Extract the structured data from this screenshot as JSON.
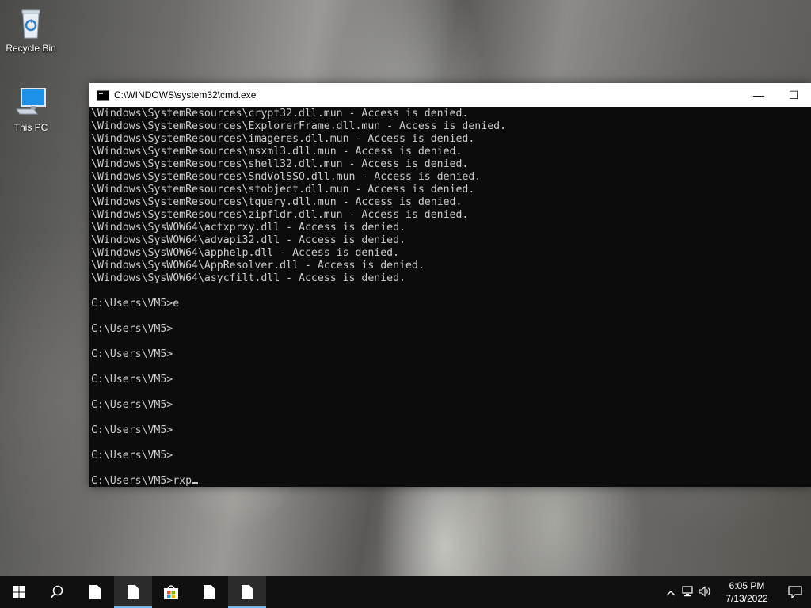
{
  "desktop": {
    "icons": [
      {
        "label": "Recycle Bin"
      },
      {
        "label": "This PC"
      }
    ]
  },
  "cmd": {
    "title": "C:\\WINDOWS\\system32\\cmd.exe",
    "lines": [
      "\\Windows\\SystemResources\\crypt32.dll.mun - Access is denied.",
      "\\Windows\\SystemResources\\ExplorerFrame.dll.mun - Access is denied.",
      "\\Windows\\SystemResources\\imageres.dll.mun - Access is denied.",
      "\\Windows\\SystemResources\\msxml3.dll.mun - Access is denied.",
      "\\Windows\\SystemResources\\shell32.dll.mun - Access is denied.",
      "\\Windows\\SystemResources\\SndVolSSO.dll.mun - Access is denied.",
      "\\Windows\\SystemResources\\stobject.dll.mun - Access is denied.",
      "\\Windows\\SystemResources\\tquery.dll.mun - Access is denied.",
      "\\Windows\\SystemResources\\zipfldr.dll.mun - Access is denied.",
      "\\Windows\\SysWOW64\\actxprxy.dll - Access is denied.",
      "\\Windows\\SysWOW64\\advapi32.dll - Access is denied.",
      "\\Windows\\SysWOW64\\apphelp.dll - Access is denied.",
      "\\Windows\\SysWOW64\\AppResolver.dll - Access is denied.",
      "\\Windows\\SysWOW64\\asycfilt.dll - Access is denied.",
      "",
      "C:\\Users\\VM5>e",
      "",
      "C:\\Users\\VM5>",
      "",
      "C:\\Users\\VM5>",
      "",
      "C:\\Users\\VM5>",
      "",
      "C:\\Users\\VM5>",
      "",
      "C:\\Users\\VM5>",
      "",
      "C:\\Users\\VM5>",
      ""
    ],
    "current_line": "C:\\Users\\VM5>rxp",
    "text_color": "#cccccc",
    "background": "#0c0c0c"
  },
  "window_controls": {
    "minimize": "—",
    "maximize": "☐"
  },
  "taskbar": {
    "start_icon": "windows-logo-icon",
    "search_icon": "search-icon",
    "pinned": [
      "document-icon",
      "document-icon",
      "store-icon",
      "document-icon",
      "document-icon"
    ],
    "active_index": 4,
    "accent": "#76b9ed",
    "tray": {
      "chevron": "^",
      "network_icon": "network-icon",
      "volume_icon": "volume-icon",
      "time": "6:05 PM",
      "date": "7/13/2022"
    }
  }
}
